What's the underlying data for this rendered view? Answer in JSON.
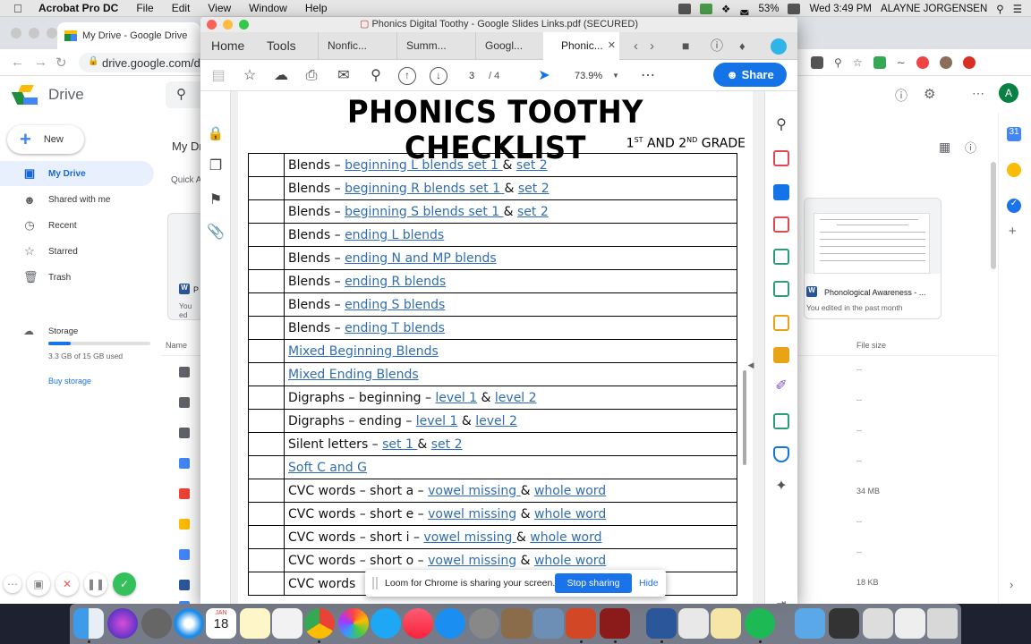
{
  "menubar": {
    "app": "Acrobat Pro DC",
    "items": [
      "File",
      "Edit",
      "View",
      "Window",
      "Help"
    ],
    "battery": "53%",
    "clock": "Wed 3:49 PM",
    "user": "ALAYNE JORGENSEN"
  },
  "chrome": {
    "tab_title": "My Drive - Google Drive",
    "url": "drive.google.com/dri"
  },
  "drive": {
    "title": "Drive",
    "new_label": "New",
    "nav": [
      "My Drive",
      "Shared with me",
      "Recent",
      "Starred",
      "Trash"
    ],
    "storage_label": "Storage",
    "storage_used": "3.3 GB of 15 GB used",
    "storage_fraction": 0.22,
    "buy_storage": "Buy storage",
    "breadcrumb": "My Dr",
    "quick_access": "Quick A",
    "name_header": "Name",
    "file_size_header": "File size",
    "sizes": [
      "--",
      "--",
      "--",
      "--",
      "34 MB",
      "--",
      "--",
      "18 KB",
      "--"
    ],
    "card_name": "Phonological Awareness - ...",
    "card_sub": "You edited in the past month",
    "left_card_letter": "P",
    "left_card_sub": "You ed"
  },
  "acrobat": {
    "window_title": "Phonics Digital Toothy - Google Slides Links.pdf (SECURED)",
    "tabs": [
      "Home",
      "Tools",
      "Nonfic...",
      "Summ...",
      "Googl...",
      "Phonic..."
    ],
    "page_current": "3",
    "page_total": "/ 4",
    "zoom": "73.9%",
    "share": "Share"
  },
  "document": {
    "title": "PHONICS TOOTHY CHECKLIST",
    "subtitle_grade1": "1",
    "subtitle_sup1": "ST",
    "subtitle_mid": " AND 2",
    "subtitle_sup2": "ND",
    "subtitle_end": " GRADE",
    "rows": [
      {
        "pre": "Blends – ",
        "l1": "beginning L blends set 1 ",
        "mid": "& ",
        "l2": "set 2"
      },
      {
        "pre": "Blends – ",
        "l1": "beginning R blends set 1 ",
        "mid": "& ",
        "l2": "set 2"
      },
      {
        "pre": "Blends – ",
        "l1": "beginning S blends set 1 ",
        "mid": "& ",
        "l2": "set 2"
      },
      {
        "pre": "Blends – ",
        "l1": "ending L blends",
        "mid": "",
        "l2": ""
      },
      {
        "pre": "Blends – ",
        "l1": "ending N and MP blends",
        "mid": "",
        "l2": ""
      },
      {
        "pre": "Blends – ",
        "l1": "ending R blends",
        "mid": "",
        "l2": ""
      },
      {
        "pre": "Blends – ",
        "l1": "ending S blends",
        "mid": "",
        "l2": ""
      },
      {
        "pre": "Blends – ",
        "l1": "ending T blends",
        "mid": "",
        "l2": ""
      },
      {
        "pre": "",
        "l1": "Mixed Beginning Blends",
        "mid": "",
        "l2": ""
      },
      {
        "pre": "",
        "l1": "Mixed Ending Blends",
        "mid": "",
        "l2": ""
      },
      {
        "pre": "Digraphs – beginning – ",
        "l1": "level 1",
        "mid": " & ",
        "l2": "level 2"
      },
      {
        "pre": "Digraphs – ending – ",
        "l1": "level 1",
        "mid": " & ",
        "l2": "level 2"
      },
      {
        "pre": "Silent letters – ",
        "l1": "set 1 ",
        "mid": "& ",
        "l2": "set 2"
      },
      {
        "pre": "",
        "l1": "Soft C and G",
        "mid": "",
        "l2": ""
      },
      {
        "pre": "CVC words – short a – ",
        "l1": "vowel missing ",
        "mid": "& ",
        "l2": "whole word"
      },
      {
        "pre": "CVC words – short e – ",
        "l1": "vowel missing",
        "mid": " & ",
        "l2": "whole word"
      },
      {
        "pre": "CVC words – short i – ",
        "l1": "vowel missing ",
        "mid": "& ",
        "l2": "whole word"
      },
      {
        "pre": "CVC words – short o – ",
        "l1": "vowel missing",
        "mid": " & ",
        "l2": "whole word"
      },
      {
        "pre": "CVC words",
        "l1": "",
        "mid": "",
        "l2": ""
      }
    ]
  },
  "loom": {
    "message": "Loom for Chrome is sharing your screen.",
    "stop": "Stop sharing",
    "hide": "Hide"
  },
  "dock": {
    "calendar_month": "JAN",
    "calendar_day": "18"
  },
  "colors": {
    "link": "#2f6db3",
    "share_button": "#1473e6",
    "drive_selected": "#e8f0fe",
    "loom_stop": "#1a73e8"
  }
}
